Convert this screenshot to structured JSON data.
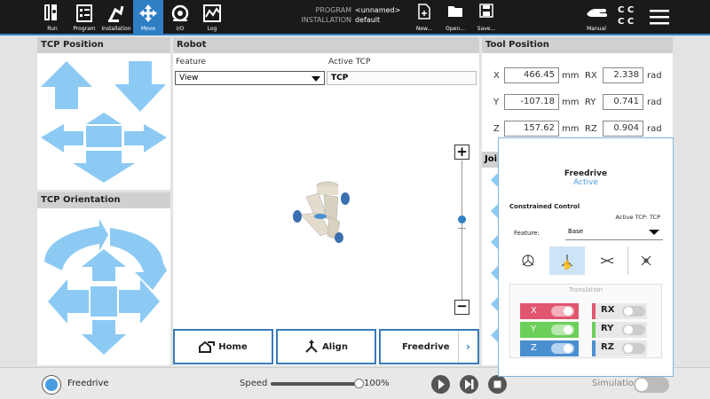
{
  "topbar": {
    "nav": [
      {
        "label": "Run",
        "icon": "ur-logo-icon"
      },
      {
        "label": "Program",
        "icon": "program-icon"
      },
      {
        "label": "Installation",
        "icon": "installation-icon"
      },
      {
        "label": "Move",
        "icon": "move-icon"
      },
      {
        "label": "I/O",
        "icon": "io-icon"
      },
      {
        "label": "Log",
        "icon": "log-icon"
      }
    ],
    "program_key": "PROGRAM",
    "program_value": "<unnamed>",
    "installation_key": "INSTALLATION",
    "installation_value": "default",
    "new_label": "New...",
    "open_label": "Open...",
    "save_label": "Save...",
    "mode_label": "Manual",
    "cc_1": "C C",
    "cc_2": "C C"
  },
  "tcp_position": {
    "title": "TCP Position"
  },
  "tcp_orientation": {
    "title": "TCP Orientation"
  },
  "robot": {
    "title": "Robot",
    "feature_label": "Feature",
    "feature_value": "View",
    "active_tcp_label": "Active TCP",
    "active_tcp_value": "TCP",
    "home_label": "Home",
    "align_label": "Align",
    "freedrive_label": "Freedrive"
  },
  "tool_position": {
    "title": "Tool Position",
    "rows": [
      {
        "axis": "X",
        "value": "466.45",
        "unit": "mm",
        "raxis": "RX",
        "rvalue": "2.338",
        "runit": "rad"
      },
      {
        "axis": "Y",
        "value": "-107.18",
        "unit": "mm",
        "raxis": "RY",
        "rvalue": "0.741",
        "runit": "rad"
      },
      {
        "axis": "Z",
        "value": "157.62",
        "unit": "mm",
        "raxis": "RZ",
        "rvalue": "0.904",
        "runit": "rad"
      }
    ],
    "joint_tab": "Joi"
  },
  "freedrive_panel": {
    "title": "Freedrive",
    "status": "Active",
    "constrained": "Constrained Control",
    "active_tcp": "Active TCP:  TCP",
    "feature_label": "Feature:",
    "feature_value": "Base",
    "translation": "Translation",
    "axes": [
      {
        "label": "X",
        "color": "#e0566e"
      },
      {
        "label": "Y",
        "color": "#6ccf5a"
      },
      {
        "label": "Z",
        "color": "#4a8fd0"
      }
    ],
    "raxes": [
      {
        "label": "RX",
        "color": "#e0566e"
      },
      {
        "label": "RY",
        "color": "#6ccf5a"
      },
      {
        "label": "RZ",
        "color": "#4a8fd0"
      }
    ]
  },
  "status": {
    "mode": "Freedrive",
    "speed_label": "Speed",
    "speed_value": "100%",
    "speed_fraction": 1.0,
    "simulation_label": "Simulation"
  }
}
